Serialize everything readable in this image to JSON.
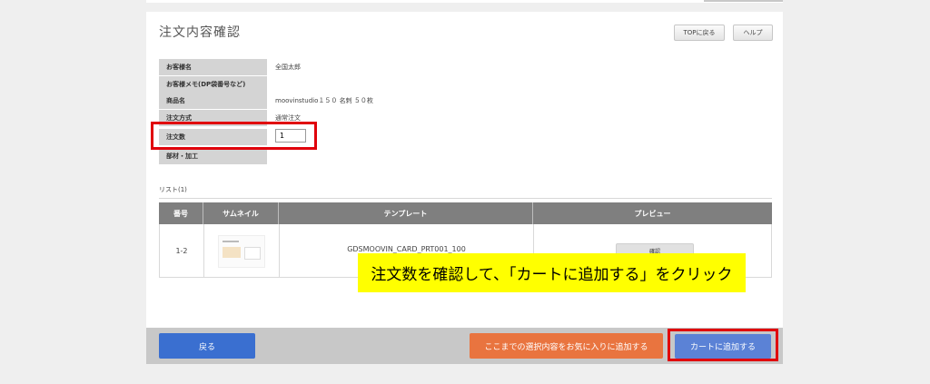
{
  "page": {
    "title": "注文内容確認",
    "top_button": "TOPに戻る",
    "help_button": "ヘルプ"
  },
  "info": [
    {
      "label": "お客様名",
      "value": "全国太郎"
    },
    {
      "label": "お客様メモ(DP袋番号など)",
      "value": ""
    },
    {
      "label": "商品名",
      "value": "moovinstudio１５０ 名刺 ５０枚"
    },
    {
      "label": "注文方式",
      "value": "通常注文"
    },
    {
      "label": "注文数",
      "value": "1"
    },
    {
      "label": "部材・加工",
      "value": ""
    }
  ],
  "list": {
    "label": "リスト(1)",
    "headers": [
      "番号",
      "サムネイル",
      "テンプレート",
      "プレビュー"
    ],
    "rows": [
      {
        "number": "1-2",
        "template": "GDSMOOVIN_CARD_PRT001_100",
        "preview_button": "確認"
      }
    ]
  },
  "banner": {
    "text": "注文数を確認して、「カートに追加する」をクリック",
    "color": "#ffff00"
  },
  "footer": {
    "back_button": "戻る",
    "favorite_button": "ここまでの選択内容をお気に入りに追加する",
    "cart_button": "カートに追加する"
  },
  "colors": {
    "highlight_border": "#e0000b",
    "back_button": "#3a6fd0",
    "favorite_button": "#e9743f",
    "cart_button": "#5b82d6"
  }
}
